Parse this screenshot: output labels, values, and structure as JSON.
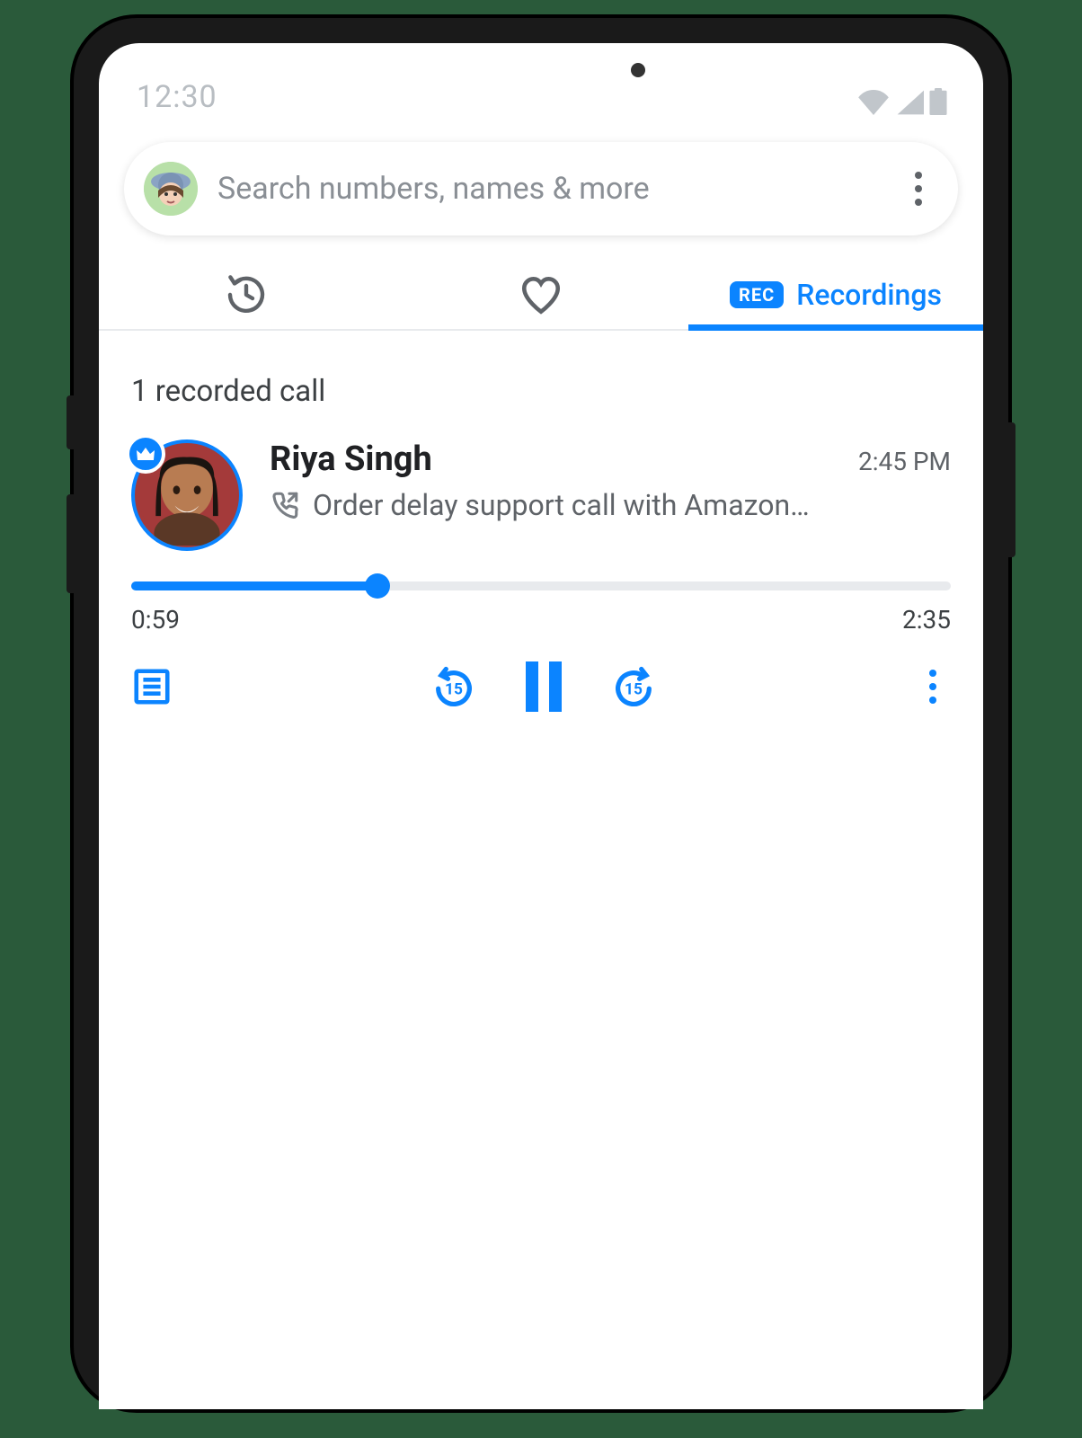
{
  "status": {
    "time": "12:30"
  },
  "search": {
    "placeholder": "Search numbers, names & more"
  },
  "tabs": {
    "recordings_badge": "REC",
    "recordings_label": "Recordings"
  },
  "section": {
    "header": "1 recorded call"
  },
  "recording": {
    "name": "Riya Singh",
    "time": "2:45 PM",
    "subtitle": "Order delay support call with Amazon…"
  },
  "player": {
    "elapsed": "0:59",
    "total": "2:35",
    "progress_pct": 30,
    "skip_seconds": "15"
  },
  "colors": {
    "accent": "#0b84ff"
  }
}
